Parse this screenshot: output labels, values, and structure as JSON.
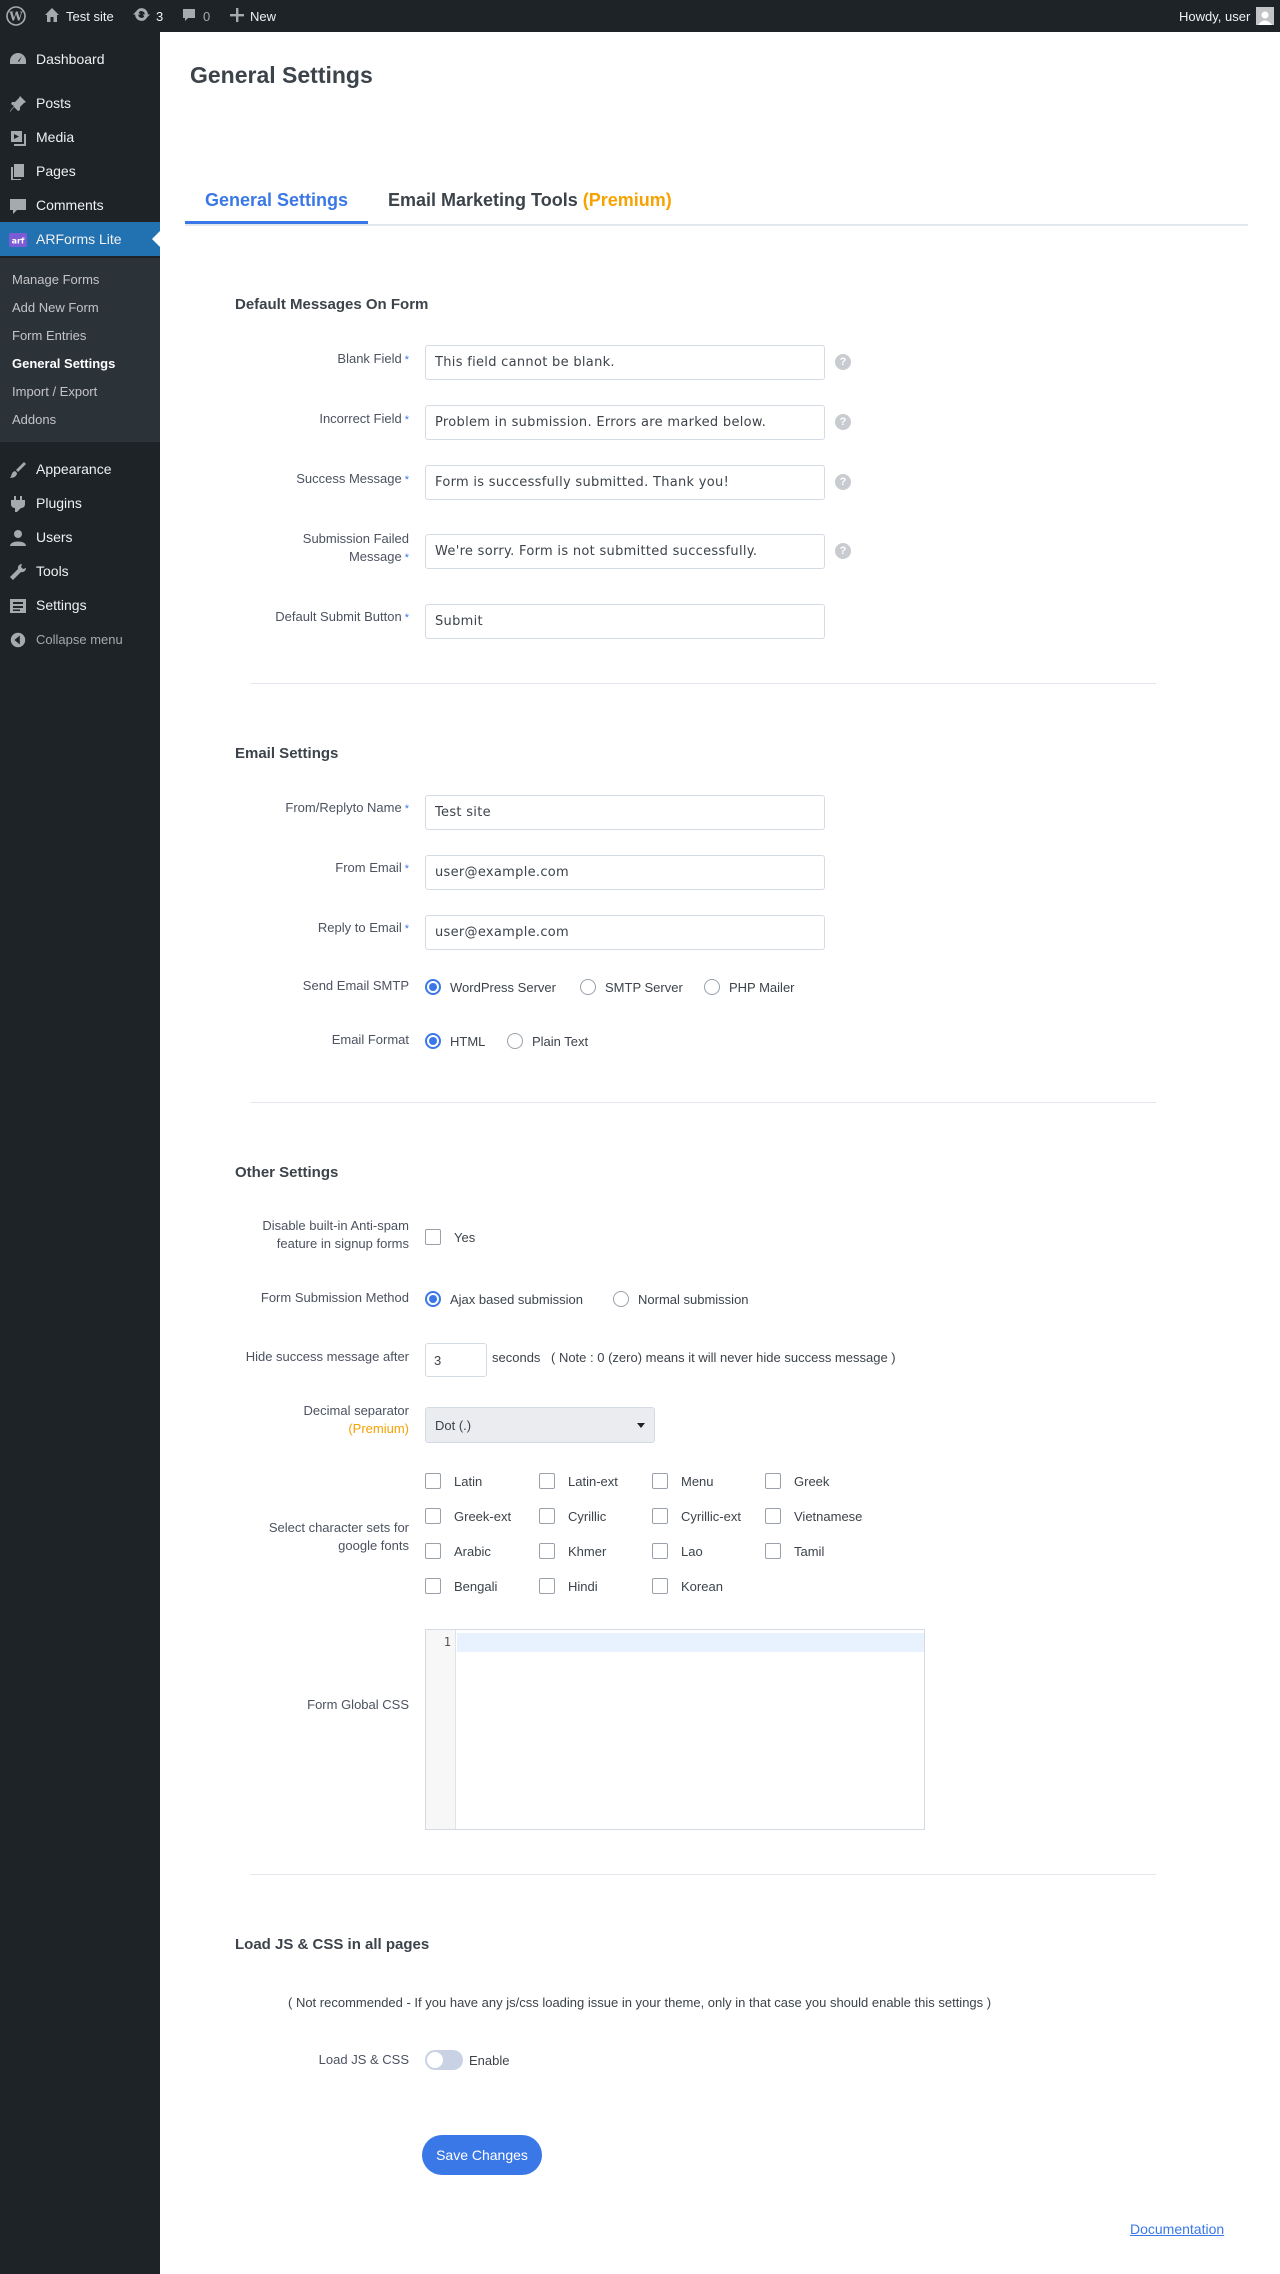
{
  "adminbar": {
    "site_name": "Test site",
    "updates_count": "3",
    "comments_count": "0",
    "new_label": "New",
    "howdy": "Howdy, user"
  },
  "sidebar": {
    "items": [
      {
        "label": "Dashboard",
        "icon": "dashboard-icon"
      },
      {
        "label": "Posts",
        "icon": "pin-icon"
      },
      {
        "label": "Media",
        "icon": "media-icon"
      },
      {
        "label": "Pages",
        "icon": "pages-icon"
      },
      {
        "label": "Comments",
        "icon": "comment-icon"
      },
      {
        "label": "ARForms Lite",
        "icon": "arforms-icon"
      },
      {
        "label": "Appearance",
        "icon": "brush-icon"
      },
      {
        "label": "Plugins",
        "icon": "plugin-icon"
      },
      {
        "label": "Users",
        "icon": "user-icon"
      },
      {
        "label": "Tools",
        "icon": "wrench-icon"
      },
      {
        "label": "Settings",
        "icon": "settings-icon"
      },
      {
        "label": "Collapse menu",
        "icon": "collapse-icon"
      }
    ],
    "submenu": [
      "Manage Forms",
      "Add New Form",
      "Form Entries",
      "General Settings",
      "Import / Export",
      "Addons"
    ]
  },
  "page": {
    "title": "General Settings",
    "tabs": {
      "general": "General Settings",
      "email_marketing": "Email Marketing Tools",
      "premium_tag": "(Premium)"
    }
  },
  "default_messages": {
    "section_title": "Default Messages On Form",
    "blank_field": {
      "label": "Blank Field",
      "value": "This field cannot be blank."
    },
    "incorrect_field": {
      "label": "Incorrect Field",
      "value": "Problem in submission. Errors are marked below."
    },
    "success_message": {
      "label": "Success Message",
      "value": "Form is successfully submitted. Thank you!"
    },
    "submission_failed": {
      "label_line1": "Submission Failed",
      "label_line2": "Message",
      "value": "We're sorry. Form is not submitted successfully."
    },
    "submit_button": {
      "label": "Default Submit Button",
      "value": "Submit"
    },
    "required_mark": "*",
    "help_mark": "?"
  },
  "email_settings": {
    "section_title": "Email Settings",
    "from_name": {
      "label": "From/Replyto Name",
      "value": "Test site"
    },
    "from_email": {
      "label": "From Email",
      "value": "user@example.com"
    },
    "reply_email": {
      "label": "Reply to Email",
      "value": "user@example.com"
    },
    "smtp": {
      "label": "Send Email SMTP",
      "options": [
        "WordPress Server",
        "SMTP Server",
        "PHP Mailer"
      ],
      "selected": "WordPress Server"
    },
    "format": {
      "label": "Email Format",
      "options": [
        "HTML",
        "Plain Text"
      ],
      "selected": "HTML"
    }
  },
  "other_settings": {
    "section_title": "Other Settings",
    "antispam": {
      "label_line1": "Disable built-in Anti-spam",
      "label_line2": "feature in signup forms",
      "option": "Yes"
    },
    "submission_method": {
      "label": "Form Submission Method",
      "options": [
        "Ajax based submission",
        "Normal submission"
      ],
      "selected": "Ajax based submission"
    },
    "hide_success": {
      "label": "Hide success message after",
      "value": "3",
      "unit": "seconds",
      "note": "( Note : 0 (zero) means it will never hide success message )"
    },
    "decimal": {
      "label": "Decimal separator",
      "premium_tag": "(Premium)",
      "value": "Dot (.)"
    },
    "charsets": {
      "label_line1": "Select character sets for",
      "label_line2": "google fonts",
      "options": [
        "Latin",
        "Latin-ext",
        "Menu",
        "Greek",
        "Greek-ext",
        "Cyrillic",
        "Cyrillic-ext",
        "Vietnamese",
        "Arabic",
        "Khmer",
        "Lao",
        "Tamil",
        "Bengali",
        "Hindi",
        "Korean"
      ]
    },
    "global_css": {
      "label": "Form Global CSS",
      "line_number": "1"
    }
  },
  "load_js_css": {
    "section_title": "Load JS & CSS in all pages",
    "note": "( Not recommended - If you have any js/css loading issue in your theme, only in that case you should enable this settings )",
    "label": "Load JS & CSS",
    "toggle_label": "Enable",
    "enabled": false
  },
  "actions": {
    "save_label": "Save Changes",
    "documentation_label": "Documentation"
  },
  "colors": {
    "accent": "#3b78e7",
    "premium": "#f7a200",
    "sidebar_bg": "#1d2327",
    "sidebar_active": "#2271b1"
  }
}
